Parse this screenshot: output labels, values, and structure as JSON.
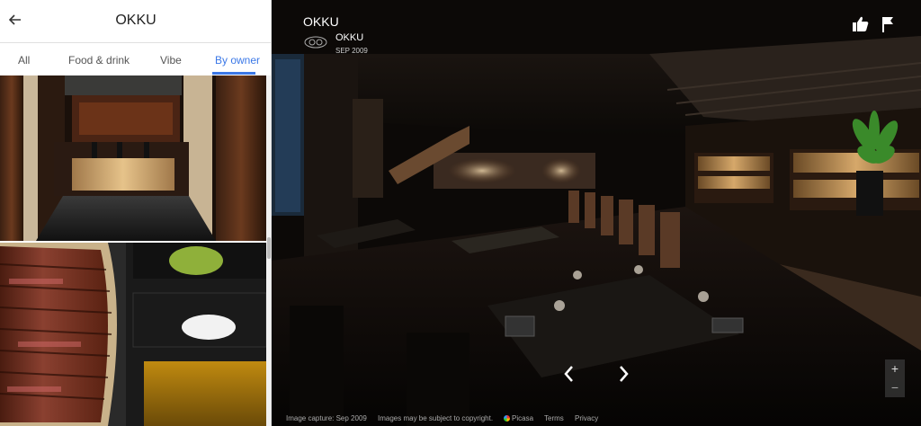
{
  "left_panel": {
    "title": "OKKU",
    "back_icon": "arrow-left-icon",
    "tabs": [
      {
        "label": "All",
        "active": false
      },
      {
        "label": "Food & drink",
        "active": false
      },
      {
        "label": "Vibe",
        "active": false
      },
      {
        "label": "By owner",
        "active": true
      }
    ],
    "accent_color": "#3b78e7",
    "photos": [
      "restaurant-bar-interior-photo",
      "sliced-steak-with-condiments-photo"
    ]
  },
  "viewer": {
    "title": "OKKU",
    "owner": {
      "logo": "okku-logo",
      "name": "OKKU",
      "date": "SEP 2009"
    },
    "actions": {
      "like_icon": "thumbs-up-icon",
      "flag_icon": "flag-icon"
    },
    "nav": {
      "prev_icon": "chevron-left-icon",
      "next_icon": "chevron-right-icon"
    },
    "zoom": {
      "in_label": "+",
      "out_label": "−"
    },
    "footer": {
      "capture": "Image capture: Sep 2009",
      "rights": "Images may be subject to copyright.",
      "picasa": "Picasa",
      "terms": "Terms",
      "privacy": "Privacy"
    }
  }
}
